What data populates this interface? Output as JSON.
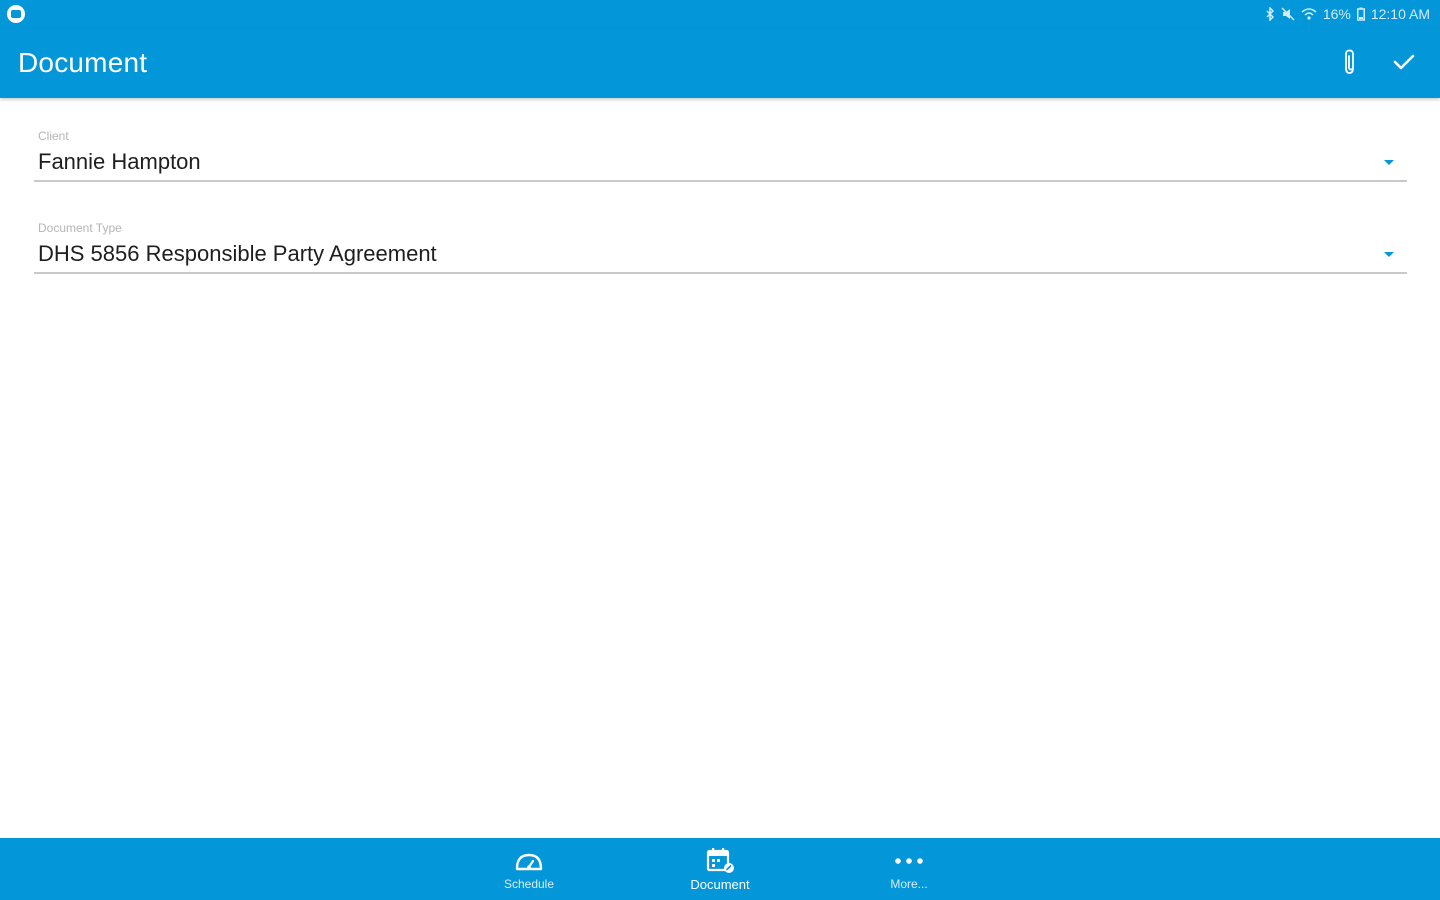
{
  "status_bar": {
    "battery": "16%",
    "time": "12:10 AM",
    "icons": [
      "app-notification-icon",
      "bluetooth-icon",
      "mute-icon",
      "wifi-icon",
      "battery-icon"
    ]
  },
  "app_bar": {
    "title": "Document",
    "actions": [
      "paperclip-icon",
      "checkmark-icon"
    ]
  },
  "form": {
    "client": {
      "label": "Client",
      "value": "Fannie Hampton"
    },
    "document_type": {
      "label": "Document Type",
      "value": "DHS 5856 Responsible Party Agreement"
    }
  },
  "bottom_nav": {
    "items": [
      {
        "label": "Schedule",
        "icon": "speedometer-icon",
        "active": false
      },
      {
        "label": "Document",
        "icon": "calendar-edit-icon",
        "active": true
      },
      {
        "label": "More...",
        "icon": "more-dots-icon",
        "active": false
      }
    ]
  },
  "colors": {
    "primary": "#0396d9",
    "text": "#1e1e1e",
    "label": "#b5b5b5",
    "underline": "#c9c9c9"
  }
}
